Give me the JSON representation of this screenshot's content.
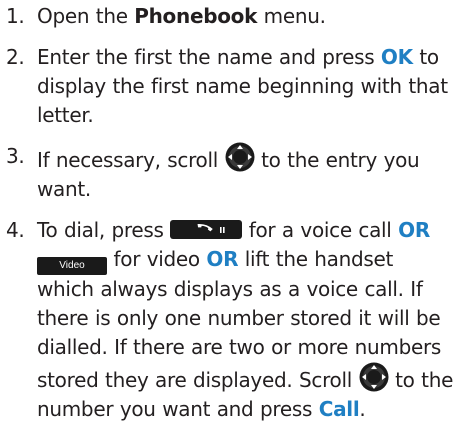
{
  "steps": [
    {
      "num": "1.",
      "t1": "Open the ",
      "b1": "Phonebook",
      "t2": " menu."
    },
    {
      "num": "2.",
      "t1": "Enter the first the name and press ",
      "k1": "OK",
      "t2": " to display the first name beginning with that letter."
    },
    {
      "num": "3.",
      "t1": "If necessary, scroll ",
      "t2": " to the entry you want."
    },
    {
      "num": "4.",
      "t1": "To dial, press ",
      "t2": " for a voice call ",
      "k1": "OR",
      "t3": " for video ",
      "k2": "OR",
      "t4": " lift the handset which always displays as a voice call. If there is only one number stored it will be dialled. If there are two or more numbers stored they are displayed. Scroll ",
      "t5": " to the number you want and press ",
      "k3": "Call",
      "t6": "."
    }
  ],
  "keys": {
    "video_label": "Video"
  },
  "icons": {
    "nav": "navigation-key-icon",
    "call": "call-key-icon",
    "video": "video-key-icon"
  },
  "colors": {
    "text": "#231f20",
    "accent": "#1f7fc3",
    "key_fill": "#1a1a1a"
  }
}
